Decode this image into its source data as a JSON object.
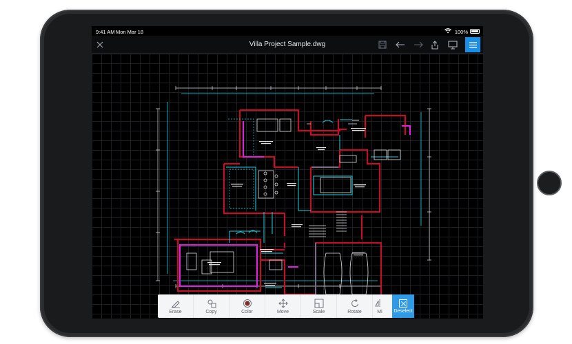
{
  "status_bar": {
    "time": "9:41 AM",
    "date": "Mon Mar 18",
    "battery": "100%"
  },
  "toolbar": {
    "title": "Villa Project Sample.dwg"
  },
  "tools": [
    {
      "label": "Erase",
      "icon": "eraser-icon"
    },
    {
      "label": "Copy",
      "icon": "copy-icon"
    },
    {
      "label": "Color",
      "icon": "color-icon"
    },
    {
      "label": "Move",
      "icon": "move-icon"
    },
    {
      "label": "Scale",
      "icon": "scale-icon"
    },
    {
      "label": "Rotate",
      "icon": "rotate-icon"
    },
    {
      "label": "Mi",
      "icon": "mirror-icon"
    }
  ],
  "deselect": {
    "label": "Deselect"
  },
  "colors": {
    "accent": "#1b8ee6",
    "cad_red": "#c0102a",
    "cad_cyan": "#19d3e6",
    "cad_magenta": "#e01fe0",
    "cad_white": "#e8e8e8"
  }
}
